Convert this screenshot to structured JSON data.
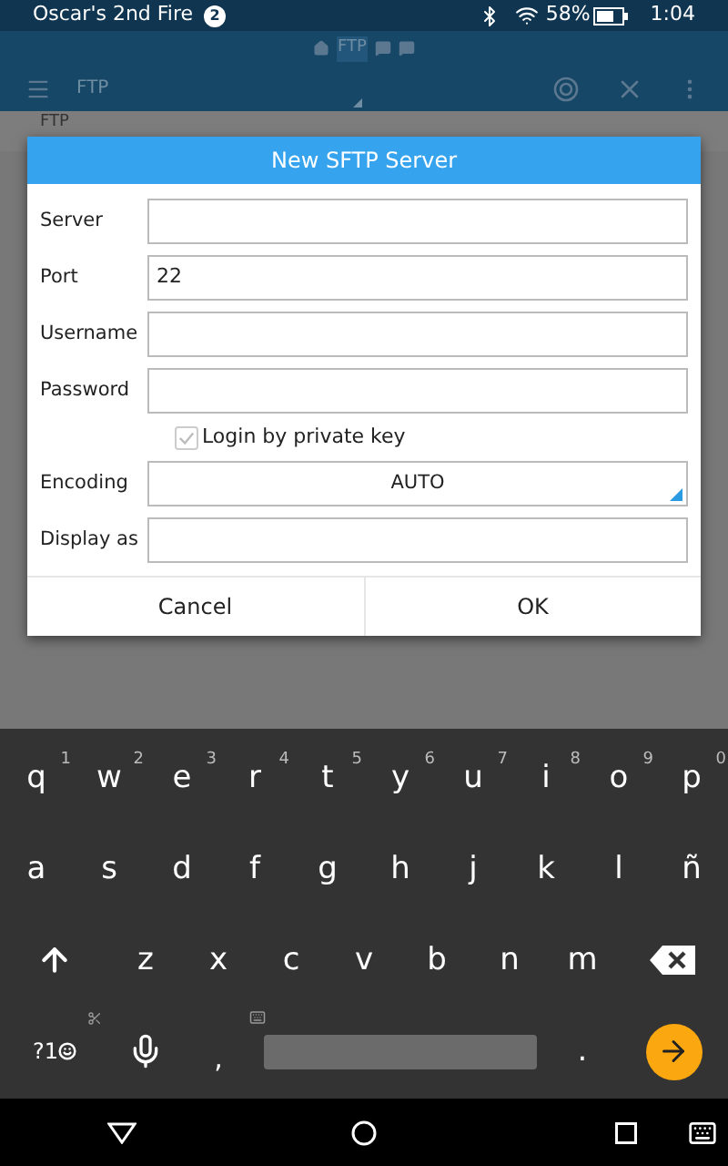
{
  "status_bar": {
    "carrier": "Oscar's 2nd Fire",
    "notification_count": "2",
    "battery": "58%",
    "time": "1:04"
  },
  "breadcrumb": {
    "label": "FTP"
  },
  "toolbar": {
    "title": "FTP"
  },
  "background_tab": {
    "label": "FTP"
  },
  "dialog": {
    "title": "New SFTP Server",
    "fields": [
      {
        "kind": "text",
        "label": "Server"
      },
      {
        "kind": "text",
        "label": "Port",
        "value": "22"
      },
      {
        "kind": "text",
        "label": "Username"
      },
      {
        "kind": "text",
        "label": "Password"
      },
      {
        "kind": "checkbox",
        "label": "Login by private key",
        "checked": true
      },
      {
        "kind": "select",
        "label": "Encoding",
        "value": "AUTO"
      },
      {
        "kind": "text",
        "label": "Display as"
      }
    ],
    "buttons": [
      "Cancel",
      "OK"
    ]
  },
  "keyboard": {
    "rows": [
      [
        {
          "label": "q",
          "hint": "1"
        },
        {
          "label": "w",
          "hint": "2"
        },
        {
          "label": "e",
          "hint": "3"
        },
        {
          "label": "r",
          "hint": "4"
        },
        {
          "label": "t",
          "hint": "5"
        },
        {
          "label": "y",
          "hint": "6"
        },
        {
          "label": "u",
          "hint": "7"
        },
        {
          "label": "i",
          "hint": "8"
        },
        {
          "label": "o",
          "hint": "9"
        },
        {
          "label": "p",
          "hint": "0"
        }
      ],
      [
        {
          "label": "a"
        },
        {
          "label": "s"
        },
        {
          "label": "d"
        },
        {
          "label": "f"
        },
        {
          "label": "g"
        },
        {
          "label": "h"
        },
        {
          "label": "j"
        },
        {
          "label": "k"
        },
        {
          "label": "l"
        },
        {
          "label": "ñ"
        }
      ],
      [
        {
          "kind": "shift"
        },
        {
          "label": "z"
        },
        {
          "label": "x"
        },
        {
          "label": "c"
        },
        {
          "label": "v"
        },
        {
          "label": "b"
        },
        {
          "label": "n"
        },
        {
          "label": "m"
        },
        {
          "kind": "backspace"
        }
      ],
      [
        {
          "kind": "symbols",
          "label": "?1"
        },
        {
          "kind": "mic"
        },
        {
          "kind": "comma",
          "label": ","
        },
        {
          "kind": "space"
        },
        {
          "label": "."
        },
        {
          "kind": "enter"
        }
      ]
    ]
  }
}
